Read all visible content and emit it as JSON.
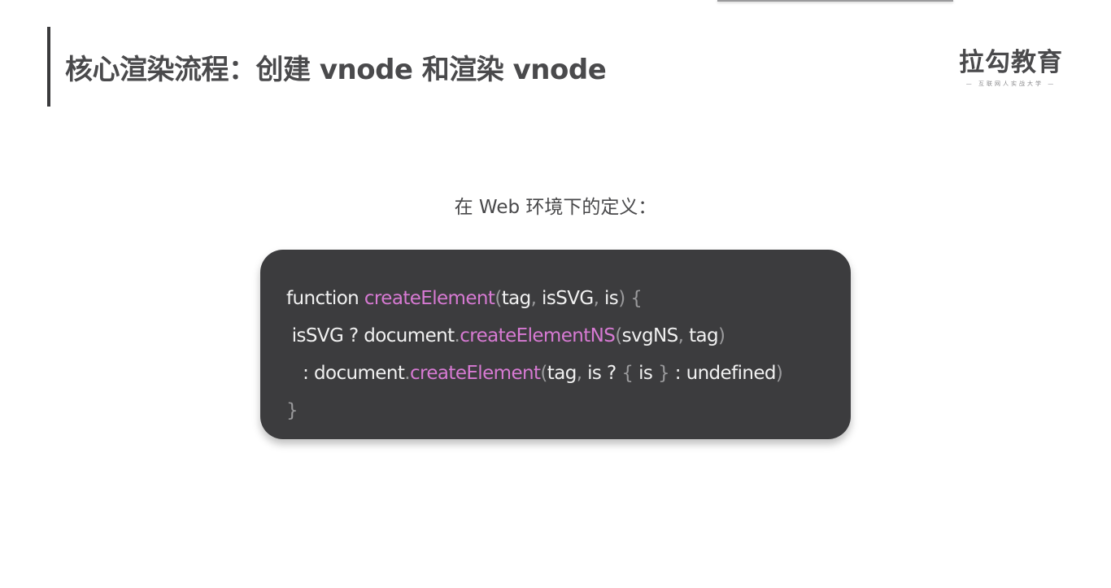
{
  "slide": {
    "title": "核心渲染流程：创建 vnode 和渲染 vnode",
    "subtitle": "在 Web 环境下的定义："
  },
  "logo": {
    "main": "拉勾教育",
    "tagline": "— 互联网人实战大学 —"
  },
  "code": {
    "lines": [
      [
        {
          "t": "function ",
          "c": "txt"
        },
        {
          "t": "createElement",
          "c": "fn"
        },
        {
          "t": "(",
          "c": "pn"
        },
        {
          "t": "tag",
          "c": "txt"
        },
        {
          "t": ", ",
          "c": "pn"
        },
        {
          "t": "isSVG",
          "c": "txt"
        },
        {
          "t": ", ",
          "c": "pn"
        },
        {
          "t": "is",
          "c": "txt"
        },
        {
          "t": ") {",
          "c": "pn"
        }
      ],
      [
        {
          "t": " isSVG ? document",
          "c": "txt"
        },
        {
          "t": ".",
          "c": "pn"
        },
        {
          "t": "createElementNS",
          "c": "fn"
        },
        {
          "t": "(",
          "c": "pn"
        },
        {
          "t": "svgNS",
          "c": "txt"
        },
        {
          "t": ", ",
          "c": "pn"
        },
        {
          "t": "tag",
          "c": "txt"
        },
        {
          "t": ")",
          "c": "pn"
        }
      ],
      [
        {
          "t": "   : document",
          "c": "txt"
        },
        {
          "t": ".",
          "c": "pn"
        },
        {
          "t": "createElement",
          "c": "fn"
        },
        {
          "t": "(",
          "c": "pn"
        },
        {
          "t": "tag",
          "c": "txt"
        },
        {
          "t": ", ",
          "c": "pn"
        },
        {
          "t": "is ? ",
          "c": "txt"
        },
        {
          "t": "{ ",
          "c": "pn"
        },
        {
          "t": "is ",
          "c": "txt"
        },
        {
          "t": "}",
          "c": "pn"
        },
        {
          "t": " : undefined",
          "c": "txt"
        },
        {
          "t": ")",
          "c": "pn"
        }
      ],
      [
        {
          "t": "}",
          "c": "pn"
        }
      ]
    ]
  }
}
